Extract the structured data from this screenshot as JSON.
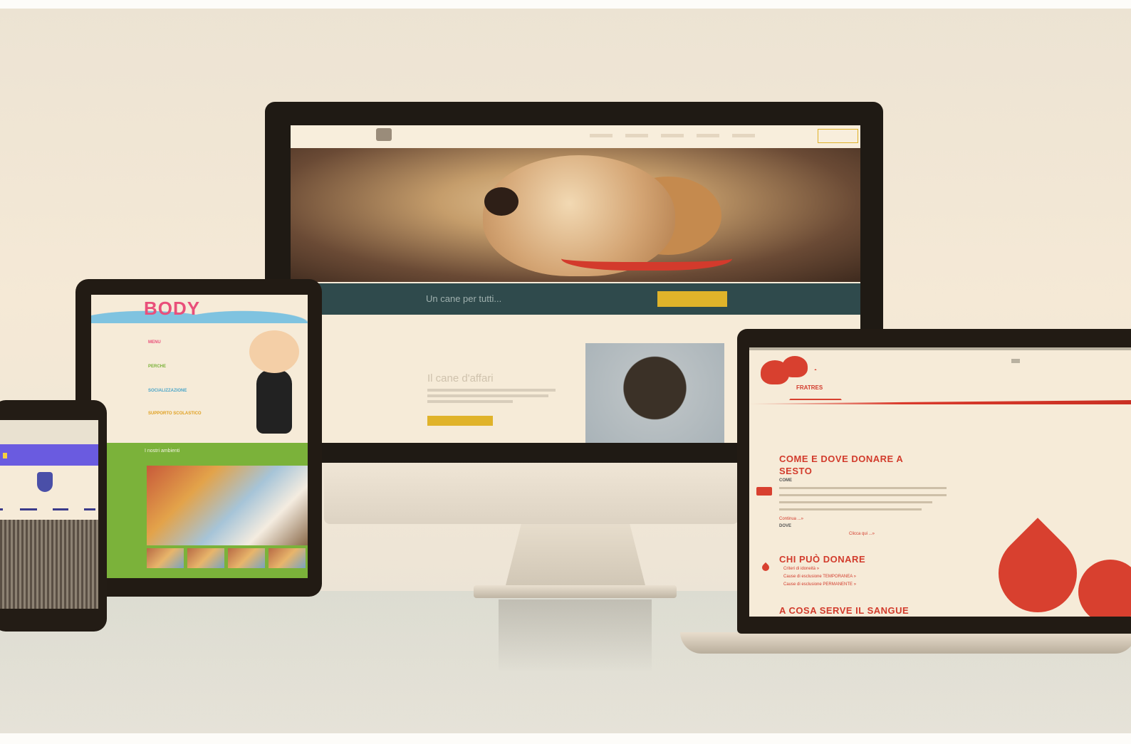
{
  "desktop": {
    "banner_text": "Un cane per tutti...",
    "section_title": "Il cane d'affari"
  },
  "tablet": {
    "logo": "BODY",
    "items": [
      "MENU",
      "PERCHE",
      "SOCIALIZZAZIONE",
      "SUPPORTO SCOLASTICO"
    ],
    "section_label": "I nostri ambienti"
  },
  "laptop": {
    "heading_1": "COME E DOVE DONARE A SESTO",
    "sub_come": "COME",
    "sub_dove": "DOVE",
    "link_continua": "Continua ...»",
    "link_clicca": "Clicca qui ...»",
    "heading_2": "CHI PUÒ DONARE",
    "list_items": [
      "Criteri di idoneità »",
      "Cause di esclusione TEMPORANEA »",
      "Cause di esclusione PERMANENTE »"
    ],
    "heading_3": "A COSA SERVE IL SANGUE",
    "logo_text": "FRATRES"
  },
  "colors": {
    "accent_red": "#d23b2c",
    "accent_yellow": "#e0b32a",
    "banner_teal": "#2f4a4c",
    "phone_purple": "#6a5be0",
    "tablet_green": "#7bb23a"
  }
}
